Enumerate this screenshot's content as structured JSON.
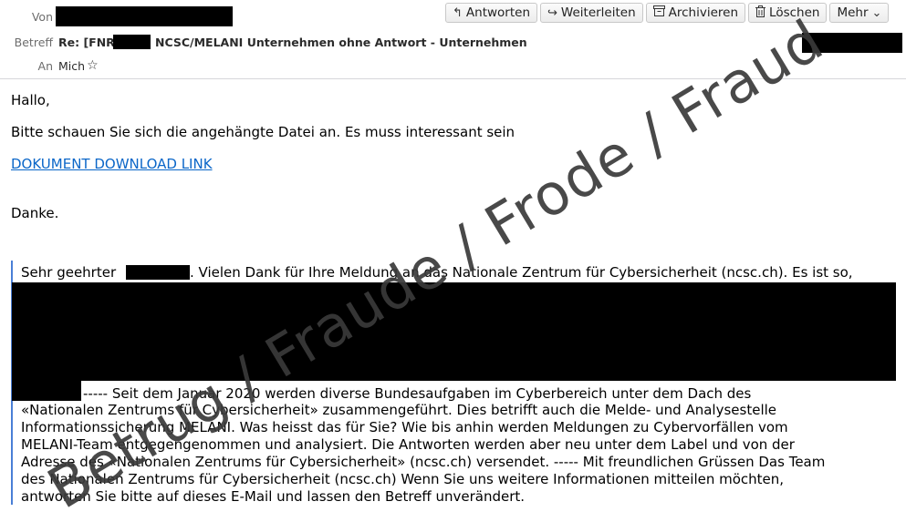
{
  "header": {
    "from_label": "Von",
    "subject_label": "Betreff",
    "to_label": "An",
    "subject_prefix": "Re: [FNR",
    "subject_rest": "NCSC/MELANI Unternehmen ohne Antwort - Unternehmen",
    "to_value": "Mich",
    "star_icon": "star-icon"
  },
  "toolbar": {
    "reply_label": "Antworten",
    "forward_label": "Weiterleiten",
    "archive_label": "Archivieren",
    "delete_label": "Löschen",
    "more_label": "Mehr",
    "icons": [
      "reply-icon",
      "forward-icon",
      "archive-icon",
      "trash-icon",
      "chevron-down-icon"
    ]
  },
  "message": {
    "greeting": "Hallo,",
    "line1": "Bitte schauen Sie sich die angehängte Datei an.  Es muss interessant sein",
    "link_text": "DOKUMENT DOWNLOAD LINK",
    "thanks": "Danke."
  },
  "quote": {
    "line1_a": "Sehr geehrter",
    "line1_b": ". Vielen Dank für Ihre Meldung an das Nationale Zentrum für Cybersicherheit (ncsc.ch). Es ist so,",
    "line2": "----- Seit dem Januar 2020 werden diverse Bundesaufgaben im Cyberbereich unter dem Dach des",
    "line3": "«Nationalen Zentrums für Cybersicherheit» zusammengeführt. Dies betrifft auch die Melde- und Analysestelle",
    "line4": "Informationssicherung MELANI. Was heisst das für Sie? Wie bis anhin werden Meldungen zu Cybervorfällen vom",
    "line5": "MELANI-Team entgegengenommen und analysiert. Die Antworten werden aber neu unter dem Label und von der",
    "line6": "Adresse des «Nationalen Zentrums für Cybersicherheit» (ncsc.ch) versendet. ----- Mit freundlichen Grüssen Das Team",
    "line7": "des Nationalen Zentrums für Cybersicherheit (ncsc.ch) Wenn Sie uns weitere Informationen mitteilen möchten,",
    "line8": "antworten Sie bitte auf dieses E-Mail und lassen den Betreff unverändert."
  },
  "watermark": "Betrug / Fraude / Frode / Fraud",
  "colors": {
    "link": "#0a66c8",
    "quote_bar": "#4a7fd6",
    "redaction": "#000000"
  }
}
